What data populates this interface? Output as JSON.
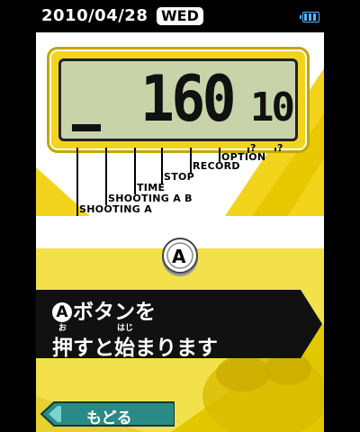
{
  "status_bar": {
    "date": "2010/04/28",
    "weekday": "WED",
    "battery_icon": "battery-icon"
  },
  "stopwatch": {
    "display_main": "160",
    "display_small": "10",
    "display_indicator": "_"
  },
  "modes": [
    {
      "label": "SHOOTING A"
    },
    {
      "label": "SHOOTING A B"
    },
    {
      "label": "TIME"
    },
    {
      "label": "STOP"
    },
    {
      "label": "RECORD"
    },
    {
      "label": "OPTION"
    },
    {
      "label": "?"
    },
    {
      "label": "?"
    }
  ],
  "prompt": {
    "button_icon": "a-button-icon",
    "button_letter": "A",
    "line1_text": "ボタンを",
    "line2_text": "押すと始まります",
    "ruby_1": "お",
    "ruby_2": "はじ"
  },
  "navigation": {
    "back_label": "もどる"
  },
  "colors": {
    "accent_yellow": "#f2d41c",
    "lcd_green": "#c9d3a9",
    "back_button_teal": "#2a8a86",
    "battery_blue": "#5ab4ff"
  }
}
